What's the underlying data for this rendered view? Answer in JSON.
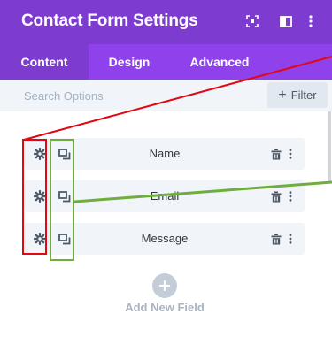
{
  "header": {
    "title": "Contact Form Settings",
    "icons": [
      "expand-icon",
      "sidebar-icon",
      "more-vertical-icon"
    ]
  },
  "tabs": [
    {
      "label": "Content",
      "active": true
    },
    {
      "label": "Design",
      "active": false
    },
    {
      "label": "Advanced",
      "active": false
    }
  ],
  "search": {
    "placeholder": "Search Options",
    "value": ""
  },
  "filter": {
    "label": "Filter",
    "icon": "plus-icon"
  },
  "fields": [
    {
      "label": "Name"
    },
    {
      "label": "Email"
    },
    {
      "label": "Message"
    }
  ],
  "field_icons": [
    "gear-icon",
    "duplicate-icon",
    "trash-icon",
    "more-vertical-icon"
  ],
  "add_field": {
    "label": "Add New Field",
    "icon": "plus-icon"
  },
  "colors": {
    "header_bg": "#7e3bd0",
    "tab_bar_bg": "#8f42ec",
    "row_bg": "#f1f5f9",
    "annotation_red": "#e30613",
    "annotation_green": "#6fae3c"
  }
}
